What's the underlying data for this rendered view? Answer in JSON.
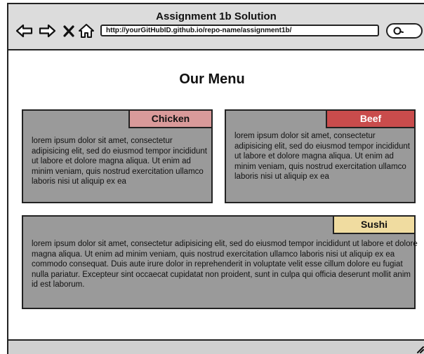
{
  "window": {
    "title": "Assignment 1b Solution"
  },
  "address_bar": {
    "url": "http://yourGitHubID.github.io/repo-name/assignment1b/"
  },
  "icons": [
    "back-arrow-icon",
    "forward-arrow-icon",
    "close-icon",
    "home-icon",
    "search-icon",
    "resize-grip-icon"
  ],
  "page": {
    "title": "Our Menu"
  },
  "menu": [
    {
      "name": "Chicken",
      "tag_color": "#d99a9a",
      "tag_text_color": "#111111",
      "text": "lorem ipsum dolor sit amet, consectetur adipisicing elit, sed do eiusmod tempor incididunt ut labore et dolore magna aliqua. Ut enim ad minim veniam, quis nostrud exercitation ullamco laboris nisi ut aliquip ex ea"
    },
    {
      "name": "Beef",
      "tag_color": "#c94c4c",
      "tag_text_color": "#ffffff",
      "text": "lorem ipsum dolor sit amet, consectetur adipisicing elit, sed do eiusmod tempor incididunt ut labore et dolore magna aliqua. Ut enim ad minim veniam, quis nostrud exercitation ullamco laboris nisi ut aliquip ex ea"
    },
    {
      "name": "Sushi",
      "tag_color": "#f0dca0",
      "tag_text_color": "#111111",
      "text": "lorem ipsum dolor sit amet, consectetur adipisicing elit, sed do eiusmod tempor incididunt ut labore et dolore magna aliqua. Ut enim ad minim veniam, quis nostrud exercitation ullamco laboris nisi ut aliquip ex ea commodo consequat. Duis aute irure dolor in reprehenderit in voluptate velit esse cillum dolore eu fugiat nulla pariatur. Excepteur sint occaecat cupidatat non proident, sunt in culpa qui officia deserunt mollit anim id est laborum."
    }
  ]
}
